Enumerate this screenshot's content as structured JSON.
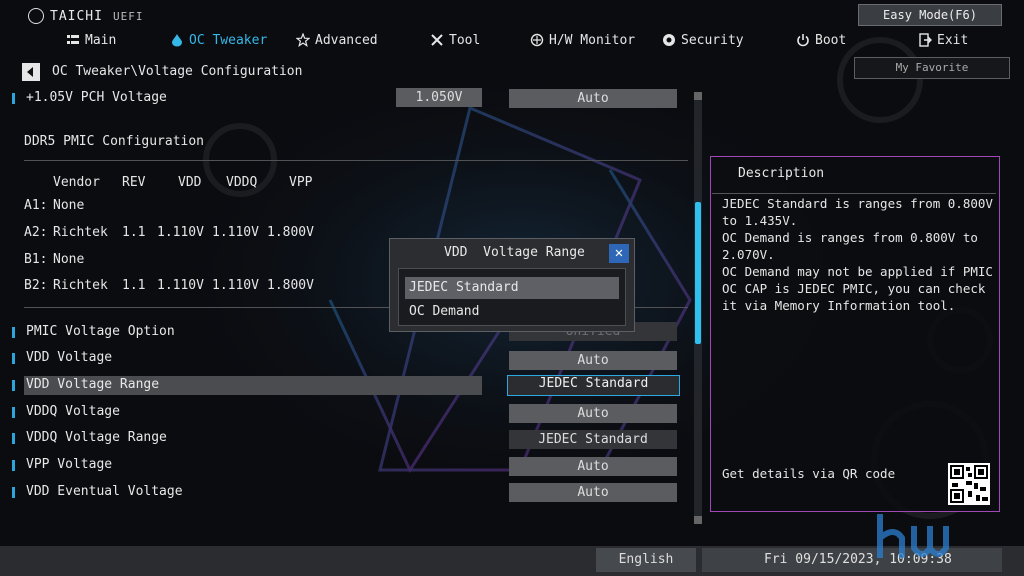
{
  "header": {
    "logo_text": "TAICHI",
    "logo_sub": "UEFI",
    "easy_mode_label": "Easy Mode(F6)",
    "my_favorite_label": "My Favorite"
  },
  "nav": [
    {
      "label": "Main",
      "icon": "list-icon"
    },
    {
      "label": "OC Tweaker",
      "icon": "droplet-icon",
      "active": true
    },
    {
      "label": "Advanced",
      "icon": "star-icon"
    },
    {
      "label": "Tool",
      "icon": "tools-icon"
    },
    {
      "label": "H/W Monitor",
      "icon": "monitor-icon"
    },
    {
      "label": "Security",
      "icon": "shield-icon"
    },
    {
      "label": "Boot",
      "icon": "power-icon"
    },
    {
      "label": "Exit",
      "icon": "exit-icon"
    }
  ],
  "breadcrumb": "OC Tweaker\\Voltage Configuration",
  "pch_row": {
    "label": "+1.05V PCH Voltage",
    "reading": "1.050V",
    "value": "Auto"
  },
  "pmic": {
    "title": "DDR5 PMIC Configuration",
    "header": [
      "Vendor",
      "REV",
      "VDD",
      "VDDQ",
      "VPP"
    ],
    "rows": [
      {
        "slot": "A1:",
        "vendor": "None",
        "rev": "",
        "vdd": "",
        "vddq": "",
        "vpp": ""
      },
      {
        "slot": "A2:",
        "vendor": "Richtek",
        "rev": "1.1",
        "vdd": "1.110V",
        "vddq": "1.110V",
        "vpp": "1.800V"
      },
      {
        "slot": "B1:",
        "vendor": "None",
        "rev": "",
        "vdd": "",
        "vddq": "",
        "vpp": ""
      },
      {
        "slot": "B2:",
        "vendor": "Richtek",
        "rev": "1.1",
        "vdd": "1.110V",
        "vddq": "1.110V",
        "vpp": "1.800V"
      }
    ]
  },
  "settings": [
    {
      "label": "PMIC Voltage Option",
      "value": "Unified"
    },
    {
      "label": "VDD  Voltage",
      "value": "Auto"
    },
    {
      "label": "VDD  Voltage Range",
      "value": "JEDEC Standard"
    },
    {
      "label": "VDDQ Voltage",
      "value": "Auto"
    },
    {
      "label": "VDDQ Voltage Range",
      "value": "JEDEC Standard"
    },
    {
      "label": "VPP  Voltage",
      "value": "Auto"
    },
    {
      "label": "VDD  Eventual Voltage",
      "value": "Auto"
    }
  ],
  "popup": {
    "title": "VDD  Voltage Range",
    "close_glyph": "✕",
    "options": [
      "JEDEC Standard",
      "OC Demand"
    ],
    "highlighted": 0
  },
  "description": {
    "title": "Description",
    "text": "JEDEC Standard is ranges from 0.800V\nto 1.435V.\nOC Demand is ranges from 0.800V to\n2.070V.\nOC Demand may not be applied if PMIC\nOC CAP is JEDEC PMIC, you can check\nit via Memory Information tool.",
    "qr_label": "Get details via QR code"
  },
  "footer": {
    "language": "English",
    "datetime": "Fri 09/15/2023, 10:09:38"
  },
  "colors": {
    "accent_blue": "#2aa6dc",
    "panel_border": "#a048b8"
  }
}
